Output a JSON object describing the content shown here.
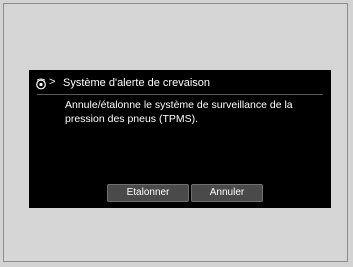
{
  "dialog": {
    "breadcrumb_separator": ">",
    "title": "Système d'alerte de crevaison",
    "message": "Annule/étalonne le système de surveillance de la\npression des pneus (TPMS).",
    "icon": "tire-pressure-icon"
  },
  "buttons": {
    "calibrate_label": "Etalonner",
    "cancel_label": "Annuler"
  },
  "colors": {
    "screen_background": "#000000",
    "button_background": "#4a4a4a",
    "text": "#ffffff"
  }
}
